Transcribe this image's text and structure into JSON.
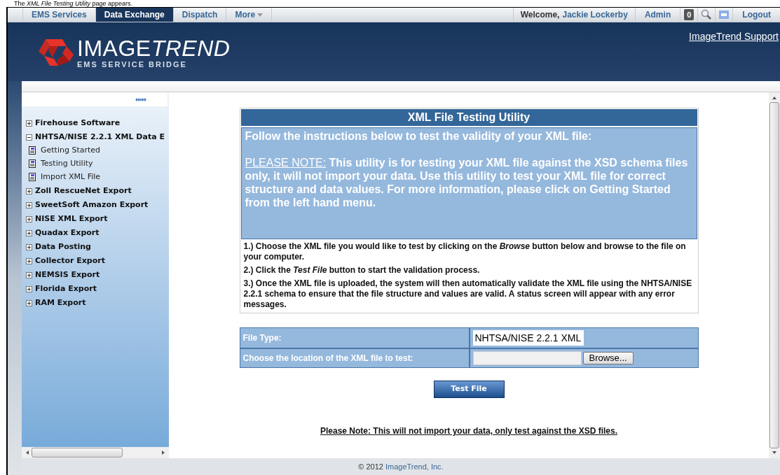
{
  "caption": "The *XML File Testing Utility* page appears.",
  "nav_tabs": [
    {
      "label": "EMS Services",
      "selected": false,
      "dropdown": false
    },
    {
      "label": "Data Exchange",
      "selected": true,
      "dropdown": false
    },
    {
      "label": "Dispatch",
      "selected": false,
      "dropdown": false
    },
    {
      "label": "More",
      "selected": false,
      "dropdown": true
    }
  ],
  "user_bar": {
    "welcome": "Welcome,",
    "user_name": "Jackie Lockerby",
    "admin": "Admin",
    "notification_count": "0",
    "logout": "Logout"
  },
  "header": {
    "logo_title": "IMAGE",
    "logo_title_italic": "TREND",
    "logo_subtitle": "EMS SERVICE BRIDGE",
    "support_link": "ImageTrend Support"
  },
  "sidebar": {
    "items": [
      {
        "label": "Firehouse Software",
        "expanded": false
      },
      {
        "label": "NHTSA/NISE 2.2.1 XML Data E",
        "expanded": true,
        "children": [
          {
            "label": "Getting Started"
          },
          {
            "label": "Testing Utility"
          },
          {
            "label": "Import XML File"
          }
        ]
      },
      {
        "label": "Zoll RescueNet Export",
        "expanded": false
      },
      {
        "label": "SweetSoft Amazon Export",
        "expanded": false
      },
      {
        "label": "NISE XML Export",
        "expanded": false
      },
      {
        "label": "Quadax Export",
        "expanded": false
      },
      {
        "label": "Data Posting",
        "expanded": false
      },
      {
        "label": "Collector Export",
        "expanded": false
      },
      {
        "label": "NEMSIS Export",
        "expanded": false
      },
      {
        "label": "Florida Export",
        "expanded": false
      },
      {
        "label": "RAM Export",
        "expanded": false
      }
    ]
  },
  "panel": {
    "title": "XML File Testing Utility",
    "intro": "Follow the instructions below to test the validity of your XML file:",
    "note_label": "PLEASE NOTE:",
    "note_text": "This utility is for testing your XML file against the XSD schema files only, it will not import your data. Use this utility to test your XML file for correct structure and data values. For more information, please click on Getting Started from the left hand menu.",
    "steps": [
      "1.) Choose the XML file you would like to test by clicking on the *Browse* button below and browse to the file on your computer.",
      "2.) Click the *Test File* button to start the validation process.",
      "3.) Once the XML file is uploaded, the system will then automatically validate the XML file using the NHTSA/NISE 2.2.1 schema to ensure that the file structure and values are valid. A status screen will appear with any error messages."
    ]
  },
  "form": [
    {
      "kind": "value",
      "label": "File Type:",
      "value": "NHTSA/NISE 2.2.1 XML"
    },
    {
      "kind": "file",
      "label": "Choose the location of the XML file to test:",
      "button": "Browse..."
    }
  ],
  "test_button": "Test File",
  "bottom_note": "Please Note: This will not import your data, only test against the XSD files.",
  "footer": {
    "copyright": "© 2012",
    "company_link": "ImageTrend, Inc."
  }
}
